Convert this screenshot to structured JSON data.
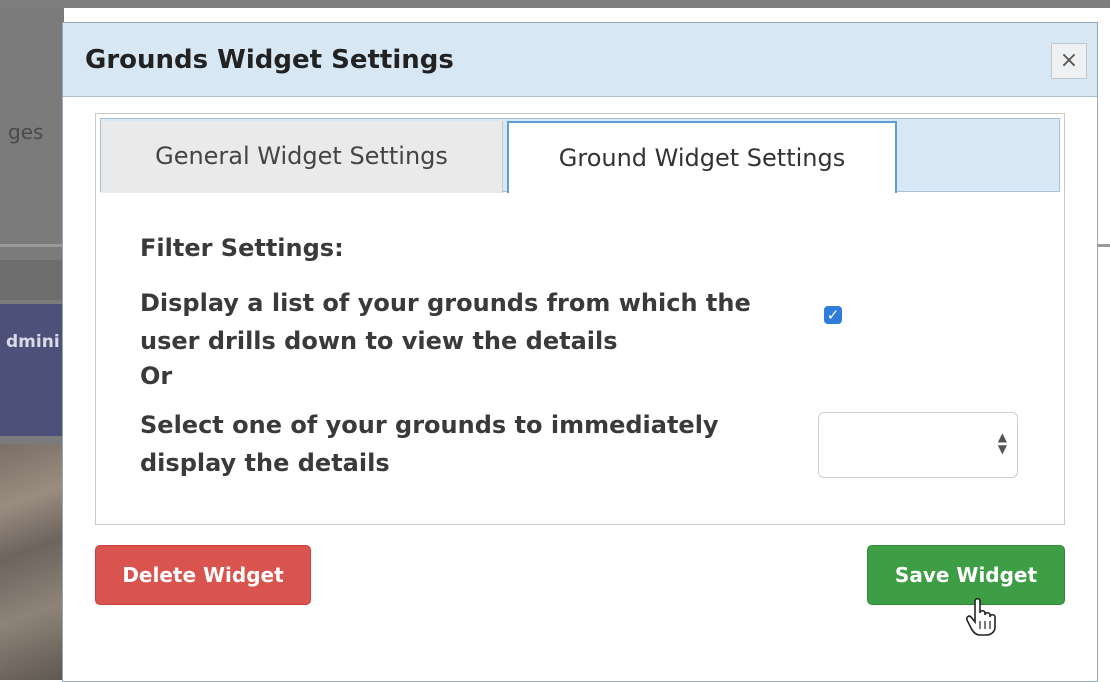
{
  "background": {
    "nav_text": "ges",
    "admin_text": "dmini"
  },
  "modal": {
    "title": "Grounds Widget Settings",
    "close_symbol": "×",
    "tabs": [
      {
        "label": "General Widget Settings",
        "active": false
      },
      {
        "label": "Ground Widget Settings",
        "active": true
      }
    ],
    "filter_heading": "Filter Settings:",
    "option_list": "Display a list of your grounds from which the user drills down to view the details",
    "option_list_checked": true,
    "or_text": "Or",
    "option_select": "Select one of your grounds to immediately display the details",
    "select_value": ""
  },
  "buttons": {
    "delete_label": "Delete Widget",
    "save_label": "Save Widget"
  },
  "colors": {
    "header_bg": "#d7e8f4",
    "delete": "#d9534f",
    "save": "#3e9e45",
    "checkbox": "#2e7ddb",
    "active_tab_border": "#5b9fd9"
  },
  "icons": {
    "close": "close-icon",
    "checkbox": "check-icon",
    "select_arrows": "select-arrows-icon",
    "cursor": "hand-pointer-icon"
  }
}
